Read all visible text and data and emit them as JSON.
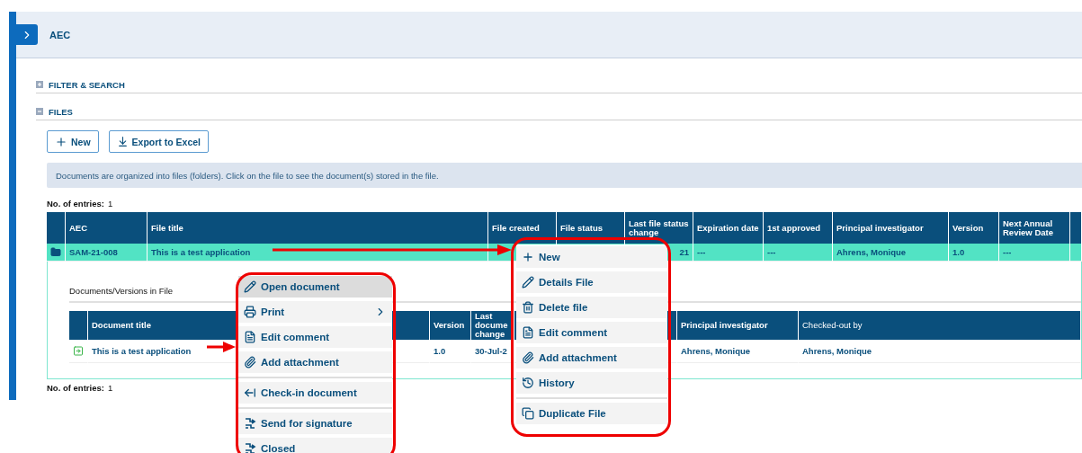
{
  "header": {
    "title": "AEC"
  },
  "sections": [
    {
      "label": "FILTER & SEARCH",
      "expanded": false
    },
    {
      "label": "FILES",
      "expanded": true
    }
  ],
  "toolbar": [
    "New",
    "Export to Excel"
  ],
  "info": "Documents are organized into files (folders). Click on the file to see the document(s) stored in the file.",
  "entries_label": "No. of entries:",
  "entries_count": "1",
  "files_table": {
    "columns": [
      "",
      "AEC",
      "File title",
      "File created",
      "File status",
      "Last file status change",
      "Expiration date",
      "1st approved",
      "Principal investigator",
      "Version",
      "Next Annual Review Date",
      ""
    ],
    "rows": [
      {
        "selected": true,
        "cells": [
          "",
          "SAM-21-008",
          "This is a test application",
          "",
          "",
          "21",
          "---",
          "---",
          "Ahrens, Monique",
          "1.0",
          "---",
          ""
        ]
      }
    ]
  },
  "documents_panel": {
    "title": "Documents/Versions in File",
    "columns": [
      "",
      "Document title",
      "Version",
      "Last docume change",
      "",
      "Principal investigator",
      "Checked-out by"
    ],
    "rows": [
      {
        "selected": false,
        "cells": [
          "",
          "This is a test application",
          "1.0",
          "30-Jul-2",
          "",
          "Ahrens, Monique",
          "Ahrens, Monique"
        ]
      }
    ]
  },
  "footer_entries_label": "No. of entries:",
  "footer_entries_count": "1",
  "document_menu": [
    {
      "kind": "item",
      "label": "Open document",
      "selected": true,
      "submenu": false
    },
    {
      "kind": "item",
      "label": "Print",
      "selected": false,
      "submenu": true
    },
    {
      "kind": "item",
      "label": "Edit comment",
      "selected": false,
      "submenu": false
    },
    {
      "kind": "item",
      "label": "Add attachment",
      "selected": false,
      "submenu": false
    },
    {
      "kind": "divider"
    },
    {
      "kind": "item",
      "label": "Check-in document",
      "selected": false,
      "submenu": false
    },
    {
      "kind": "divider"
    },
    {
      "kind": "item",
      "label": "Send for signature",
      "selected": false,
      "submenu": false
    },
    {
      "kind": "item",
      "label": "Closed",
      "selected": false,
      "submenu": false
    }
  ],
  "file_menu": [
    {
      "kind": "item",
      "label": "New",
      "selected": false,
      "submenu": false
    },
    {
      "kind": "item",
      "label": "Details File",
      "selected": false,
      "submenu": false
    },
    {
      "kind": "item",
      "label": "Delete file",
      "selected": false,
      "submenu": false
    },
    {
      "kind": "item",
      "label": "Edit comment",
      "selected": false,
      "submenu": false
    },
    {
      "kind": "item",
      "label": "Add attachment",
      "selected": false,
      "submenu": false
    },
    {
      "kind": "item",
      "label": "History",
      "selected": false,
      "submenu": false
    },
    {
      "kind": "divider"
    },
    {
      "kind": "item",
      "label": "Duplicate File",
      "selected": false,
      "submenu": false
    }
  ]
}
